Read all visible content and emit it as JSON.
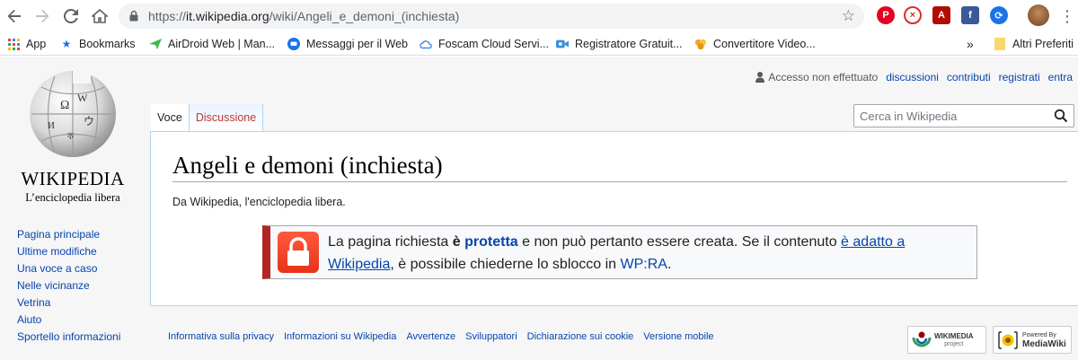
{
  "browser": {
    "url_scheme": "https://",
    "url_host": "it.wikipedia.org",
    "url_path": "/wiki/Angeli_e_demoni_(inchiesta)",
    "icons": [
      "back-icon",
      "forward-icon",
      "reload-icon",
      "home-icon",
      "lock-icon",
      "star-icon",
      "menu-icon"
    ],
    "extensions": [
      "pinterest-icon",
      "block-icon",
      "pdf-icon",
      "facebook-icon",
      "extension-icon",
      "profile-avatar"
    ]
  },
  "bookmarks": {
    "items": [
      {
        "label": "App",
        "icon": "apps-grid-icon"
      },
      {
        "label": "Bookmarks",
        "icon": "star-icon"
      },
      {
        "label": "AirDroid Web | Man...",
        "icon": "airdroid-icon"
      },
      {
        "label": "Messaggi per il Web",
        "icon": "messages-icon"
      },
      {
        "label": "Foscam Cloud Servi...",
        "icon": "cloud-icon"
      },
      {
        "label": "Registratore Gratuit...",
        "icon": "recorder-icon"
      },
      {
        "label": "Convertitore Video...",
        "icon": "converter-icon"
      }
    ],
    "overflow": "»",
    "other_folder": "Altri Preferiti"
  },
  "wiki": {
    "logo_wordmark": "WIKIPEDIA",
    "logo_tagline": "L’enciclopedia libera",
    "personal": {
      "status": "Accesso non effettuato",
      "links": [
        "discussioni",
        "contributi",
        "registrati",
        "entra"
      ]
    },
    "tabs": {
      "page": "Voce",
      "talk": "Discussione"
    },
    "search": {
      "placeholder": "Cerca in Wikipedia"
    },
    "heading": "Angeli e demoni (inchiesta)",
    "site_sub": "Da Wikipedia, l'enciclopedia libera.",
    "notice": {
      "t1": "La pagina richiesta ",
      "t2": "è",
      "t3": " ",
      "link_protetta": "protetta",
      "t4": " e non può pertanto essere creata. Se il contenuto ",
      "link_adatto_1": "è adatto a",
      "t5": " ",
      "link_adatto_2": "Wikipedia",
      "t6": ", è possibile chiederne lo sblocco in ",
      "link_wpra": "WP:RA",
      "t7": "."
    },
    "sidebar": [
      "Pagina principale",
      "Ultime modifiche",
      "Una voce a caso",
      "Nelle vicinanze",
      "Vetrina",
      "Aiuto",
      "Sportello informazioni"
    ],
    "footer": [
      "Informativa sulla privacy",
      "Informazioni su Wikipedia",
      "Avvertenze",
      "Sviluppatori",
      "Dichiarazione sui cookie",
      "Versione mobile"
    ],
    "badges": {
      "wikimedia_1": "WIKIMEDIA",
      "wikimedia_2": "project",
      "mediawiki_1": "Powered By",
      "mediawiki_2": "MediaWiki"
    }
  },
  "colors": {
    "link": "#0645ad",
    "talk_tab": "#ba3b2f",
    "notice_border": "#b32424",
    "padlock": "#e8321a"
  }
}
